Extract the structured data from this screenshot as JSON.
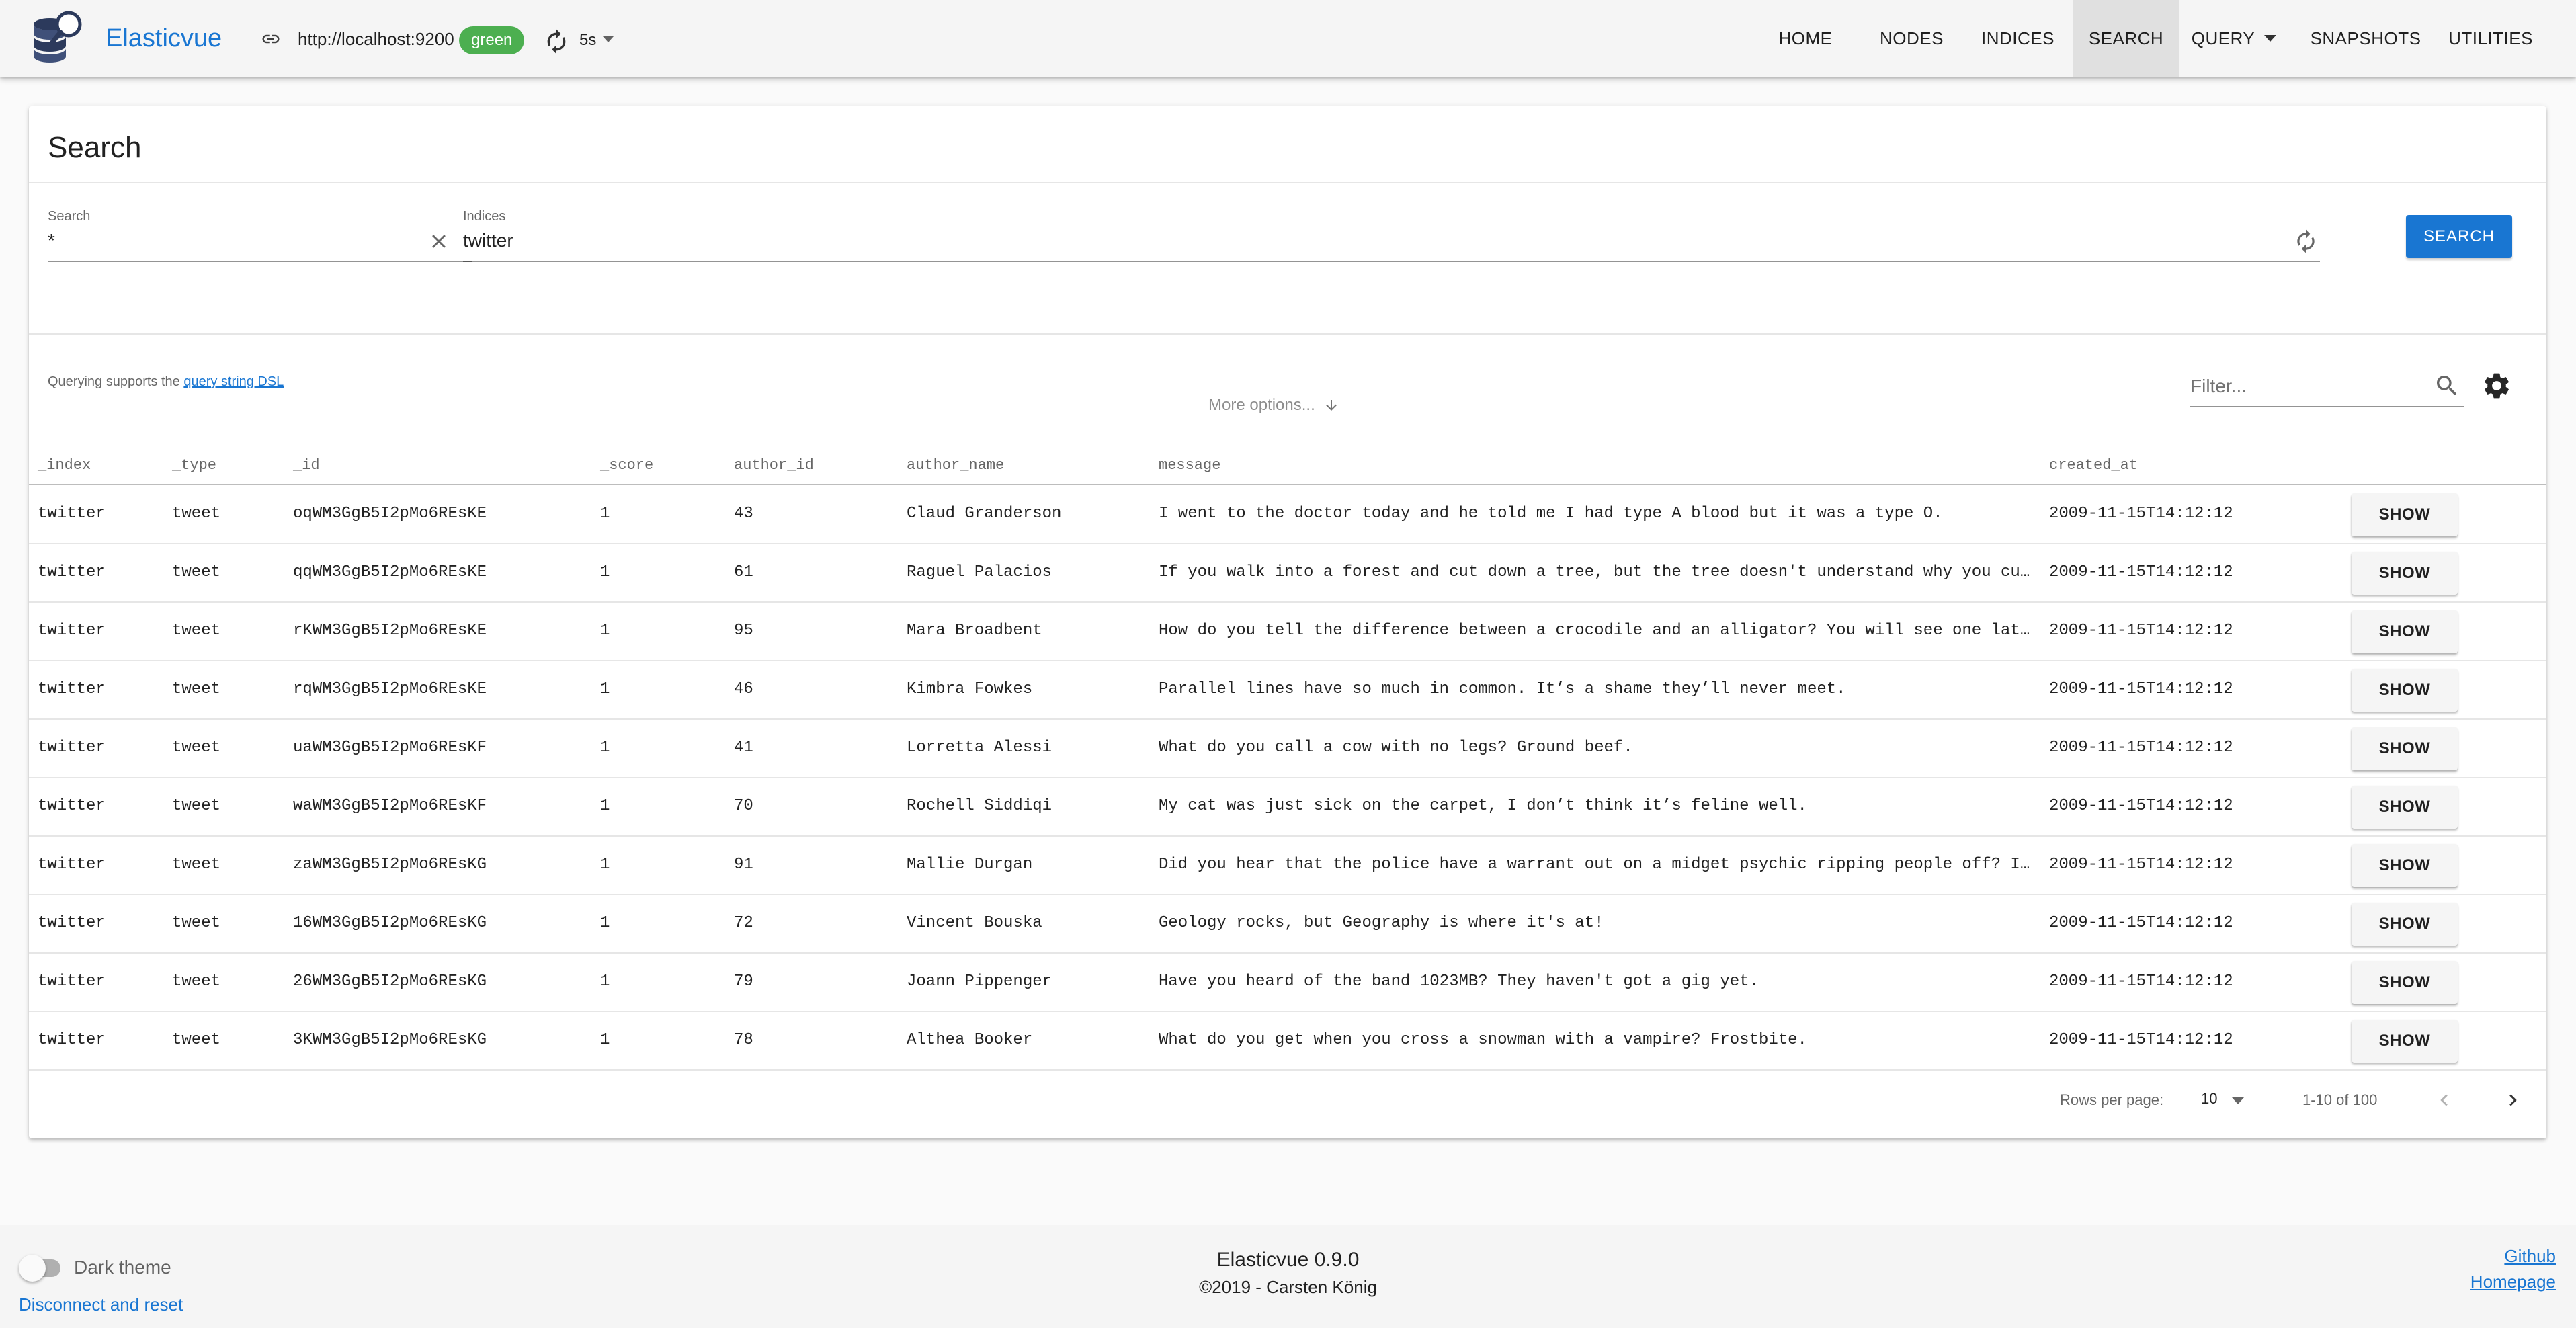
{
  "app": {
    "name": "Elasticvue",
    "cluster_url": "http://localhost:9200",
    "health": "green",
    "refresh_interval": "5s",
    "colors": {
      "primary": "#1976d2",
      "health_green": "#4caf50"
    }
  },
  "nav": {
    "home": "HOME",
    "nodes": "NODES",
    "indices": "INDICES",
    "search": "SEARCH",
    "query": "QUERY",
    "snapshots": "SNAPSHOTS",
    "utilities": "UTILITIES",
    "active": "SEARCH"
  },
  "search": {
    "title": "Search",
    "query_label": "Search",
    "query_value": "*",
    "indices_label": "Indices",
    "indices_value": "twitter",
    "hint_prefix": "Querying supports the",
    "hint_link": "query string DSL",
    "more_options": "More options...",
    "submit": "SEARCH",
    "filter_placeholder": "Filter..."
  },
  "table": {
    "columns": [
      "_index",
      "_type",
      "_id",
      "_score",
      "author_id",
      "author_name",
      "message",
      "created_at"
    ],
    "show_label": "SHOW",
    "rows": [
      [
        "twitter",
        "tweet",
        "oqWM3GgB5I2pMo6REsKE",
        "1",
        "43",
        "Claud Granderson",
        "I went to the doctor today and he told me I had type A blood but it was a type O.",
        "2009-11-15T14:12:12"
      ],
      [
        "twitter",
        "tweet",
        "qqWM3GgB5I2pMo6REsKE",
        "1",
        "61",
        "Raguel Palacios",
        "If you walk into a forest and cut down a tree, but the tree doesn't understand why you cut…",
        "2009-11-15T14:12:12"
      ],
      [
        "twitter",
        "tweet",
        "rKWM3GgB5I2pMo6REsKE",
        "1",
        "95",
        "Mara Broadbent",
        "How do you tell the difference between a crocodile and an alligator? You will see one late…",
        "2009-11-15T14:12:12"
      ],
      [
        "twitter",
        "tweet",
        "rqWM3GgB5I2pMo6REsKE",
        "1",
        "46",
        "Kimbra Fowkes",
        "Parallel lines have so much in common. It’s a shame they’ll never meet.",
        "2009-11-15T14:12:12"
      ],
      [
        "twitter",
        "tweet",
        "uaWM3GgB5I2pMo6REsKF",
        "1",
        "41",
        "Lorretta Alessi",
        "What do you call a cow with no legs? Ground beef.",
        "2009-11-15T14:12:12"
      ],
      [
        "twitter",
        "tweet",
        "waWM3GgB5I2pMo6REsKF",
        "1",
        "70",
        "Rochell Siddiqi",
        "My cat was just sick on the carpet, I don’t think it’s feline well.",
        "2009-11-15T14:12:12"
      ],
      [
        "twitter",
        "tweet",
        "zaWM3GgB5I2pMo6REsKG",
        "1",
        "91",
        "Mallie Durgan",
        "Did you hear that the police have a warrant out on a midget psychic ripping people off? It…",
        "2009-11-15T14:12:12"
      ],
      [
        "twitter",
        "tweet",
        "16WM3GgB5I2pMo6REsKG",
        "1",
        "72",
        "Vincent Bouska",
        "Geology rocks, but Geography is where it's at!",
        "2009-11-15T14:12:12"
      ],
      [
        "twitter",
        "tweet",
        "26WM3GgB5I2pMo6REsKG",
        "1",
        "79",
        "Joann Pippenger",
        "Have you heard of the band 1023MB? They haven't got a gig yet.",
        "2009-11-15T14:12:12"
      ],
      [
        "twitter",
        "tweet",
        "3KWM3GgB5I2pMo6REsKG",
        "1",
        "78",
        "Althea Booker",
        "What do you get when you cross a snowman with a vampire? Frostbite.",
        "2009-11-15T14:12:12"
      ]
    ],
    "rows_per_page_label": "Rows per page:",
    "rows_per_page": "10",
    "page_range": "1-10 of 100"
  },
  "footer": {
    "dark_theme_label": "Dark theme",
    "dark_theme_on": false,
    "disconnect": "Disconnect and reset",
    "version": "Elasticvue 0.9.0",
    "copyright": "©2019 - Carsten König",
    "github": "Github",
    "homepage": "Homepage"
  }
}
